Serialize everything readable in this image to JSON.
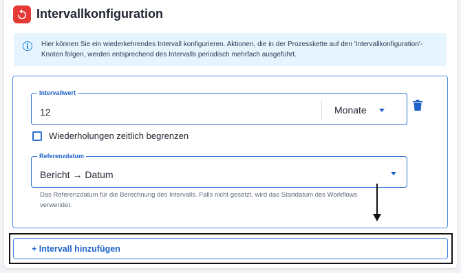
{
  "header": {
    "title": "Intervallkonfiguration",
    "icon": "reset-icon",
    "icon_color": "#e53935"
  },
  "info": {
    "icon": "info-icon",
    "text": "Hier können Sie ein wiederkehrendes Intervall konfigurieren. Aktionen, die in der Prozesskette auf den 'Intervallkonfiguration'-Knoten folgen, werden entsprechend des Intervalls periodisch mehrfach ausgeführt."
  },
  "interval": {
    "value_label": "Intervallwert",
    "value": "12",
    "unit": "Monate",
    "delete_icon": "trash-icon",
    "limit_checkbox_label": "Wiederholungen zeitlich begrenzen",
    "limit_checked": false,
    "reference_label": "Referenzdatum",
    "reference_value": "Bericht → Datum",
    "reference_helper": "Das Referenzdatum für die Berechnung des Intervalls. Falls nicht gesetzt, wird das Startdatum des Workflows verwendet."
  },
  "actions": {
    "add_interval": "+ Intervall hinzufügen"
  },
  "colors": {
    "accent": "#1e63c9",
    "info_background": "#e6f4fd",
    "border": "#4a8ee0"
  }
}
